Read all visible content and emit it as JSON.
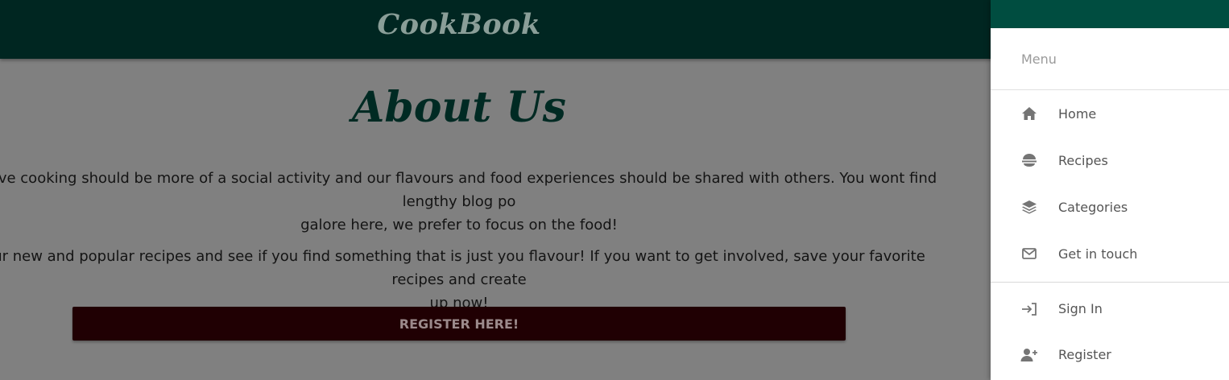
{
  "navbar": {
    "brand": "CookBook"
  },
  "about": {
    "title": "About Us",
    "paragraph1_line1": "lieve cooking should be more of a social activity and our flavours and food experiences should be shared with others. You wont find lengthy blog po",
    "paragraph1_line2": "galore here, we prefer to focus on the food!",
    "paragraph2_line1": "ur new and popular recipes and see if you find something that is just you flavour! If you want to get involved, save your favorite recipes and create",
    "paragraph2_line2": "up now!",
    "register_button": "REGISTER HERE!"
  },
  "drawer": {
    "subheader": "Menu",
    "items": [
      {
        "label": "Home",
        "icon": "home-icon"
      },
      {
        "label": "Recipes",
        "icon": "food-bowl-icon"
      },
      {
        "label": "Categories",
        "icon": "layers-icon"
      },
      {
        "label": "Get in touch",
        "icon": "envelope-icon"
      }
    ],
    "account_items": [
      {
        "label": "Sign In",
        "icon": "sign-in-icon"
      },
      {
        "label": "Register",
        "icon": "user-plus-icon"
      }
    ]
  },
  "colors": {
    "navbar": "#002621",
    "drawer_header": "#004d40",
    "overlay_gray": "#808080",
    "register_button": "#200003"
  }
}
